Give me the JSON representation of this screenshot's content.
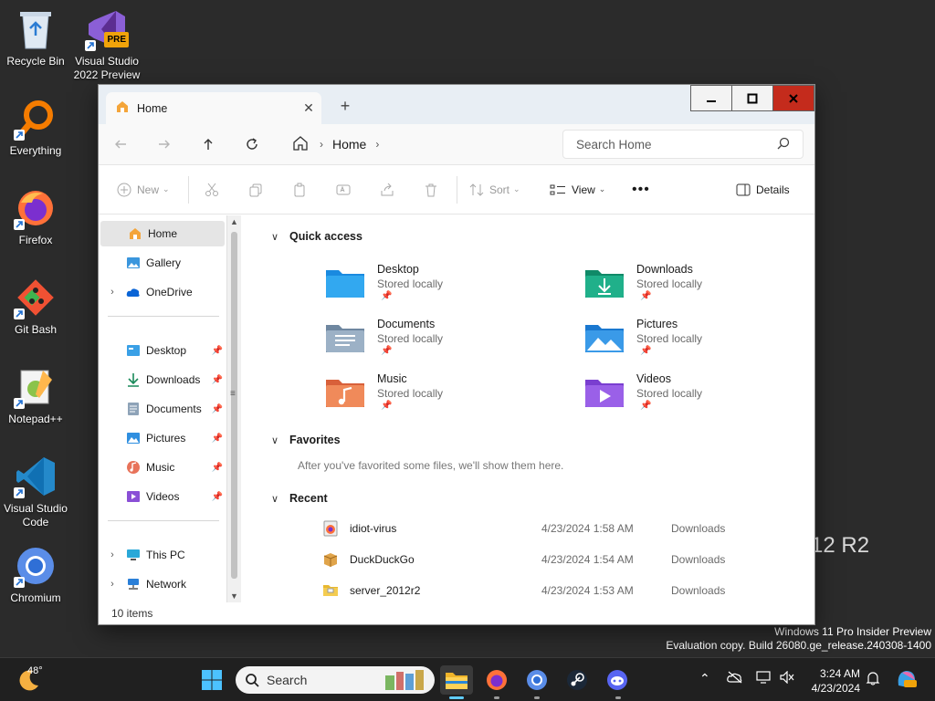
{
  "desktop": {
    "icons": [
      {
        "label": "Recycle Bin"
      },
      {
        "label": "Visual Studio 2022 Preview",
        "badge": "PRE"
      },
      {
        "label": "Everything"
      },
      {
        "label": "Firefox"
      },
      {
        "label": "Git Bash"
      },
      {
        "label": "Notepad++"
      },
      {
        "label": "Visual Studio Code"
      },
      {
        "label": "Chromium"
      }
    ],
    "bg_text": "12 R2",
    "watermark_line1": "Windows 11 Pro Insider Preview",
    "watermark_line2": "Evaluation copy. Build 26080.ge_release.240308-1400"
  },
  "window": {
    "tab_title": "Home",
    "address": {
      "crumb": "Home"
    },
    "search_placeholder": "Search Home",
    "commands": {
      "new": "New",
      "sort": "Sort",
      "view": "View",
      "details": "Details"
    },
    "nav": {
      "home": "Home",
      "gallery": "Gallery",
      "onedrive": "OneDrive",
      "desktop": "Desktop",
      "downloads": "Downloads",
      "documents": "Documents",
      "pictures": "Pictures",
      "music": "Music",
      "videos": "Videos",
      "thispc": "This PC",
      "network": "Network"
    },
    "sections": {
      "quick_access": "Quick access",
      "favorites": "Favorites",
      "favorites_empty": "After you've favorited some files, we'll show them here.",
      "recent": "Recent"
    },
    "quick_access": [
      {
        "name": "Desktop",
        "sub": "Stored locally"
      },
      {
        "name": "Downloads",
        "sub": "Stored locally"
      },
      {
        "name": "Documents",
        "sub": "Stored locally"
      },
      {
        "name": "Pictures",
        "sub": "Stored locally"
      },
      {
        "name": "Music",
        "sub": "Stored locally"
      },
      {
        "name": "Videos",
        "sub": "Stored locally"
      }
    ],
    "recent": [
      {
        "name": "idiot-virus",
        "date": "4/23/2024 1:58 AM",
        "location": "Downloads"
      },
      {
        "name": "DuckDuckGo",
        "date": "4/23/2024 1:54 AM",
        "location": "Downloads"
      },
      {
        "name": "server_2012r2",
        "date": "4/23/2024 1:53 AM",
        "location": "Downloads"
      }
    ],
    "status": "10 items"
  },
  "taskbar": {
    "search_label": "Search",
    "weather": "48°",
    "time": "3:24 AM",
    "date": "4/23/2024"
  },
  "colors": {
    "accent": "#60cdff",
    "close_red": "#c42b1c"
  }
}
